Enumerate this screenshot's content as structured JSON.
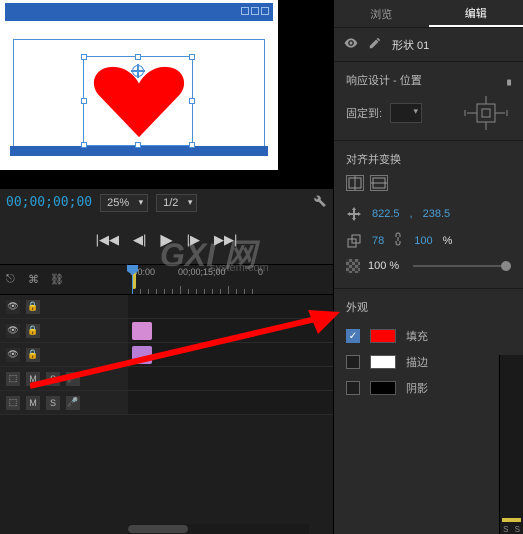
{
  "tabs": {
    "browse": "浏览",
    "edit": "编辑"
  },
  "shape": {
    "name": "形状 01"
  },
  "responsive": {
    "title": "响应设计 - 位置",
    "pin_label": "固定到:"
  },
  "transform": {
    "title": "对齐并变换",
    "pos_x": "822.5",
    "pos_y": "238.5",
    "scale_w": "78",
    "scale_h": "100",
    "scale_unit": "%",
    "opacity": "100 %"
  },
  "appearance": {
    "title": "外观",
    "fill": "填充",
    "stroke": "描边",
    "shadow": "阴影"
  },
  "transport": {
    "timecode": "00;00;00;00",
    "zoom": "25%",
    "quality": "1/2"
  },
  "timeline": {
    "t0": ":00:00",
    "t1": "00;00;15;00",
    "t2": "0"
  },
  "meter": {
    "s1": "S",
    "s2": "S"
  },
  "track": {
    "m": "M",
    "s": "S"
  },
  "watermark": {
    "main": "GXI 网",
    "sub": "system.com"
  }
}
